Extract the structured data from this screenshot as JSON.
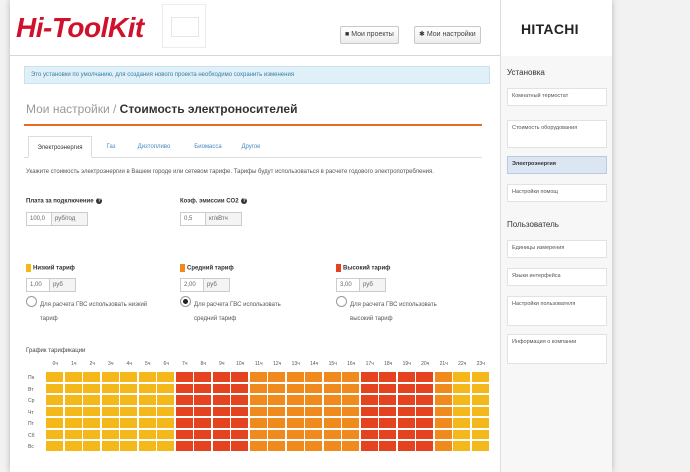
{
  "header": {
    "logo": "Hi-ToolKit",
    "btn_project": "Мои проекты",
    "btn_settings": "Мои настройки",
    "brand": "HITACHI"
  },
  "notice": "Это установки по умолчанию, для создания нового проекта необходимо сохранить изменения",
  "title": {
    "parent": "Мои настройки / ",
    "current": "Стоимость электроносителей"
  },
  "tabs": [
    "Электроэнергия",
    "Газ",
    "Дизтопливо",
    "Биомасса",
    "Другое"
  ],
  "description": "Укажите стоимость электроэнергии в Вашем городе или сетевом тарифе. Тарифы будут использоваться в расчете годового электропотребления.",
  "fields": {
    "subscription_label": "Плата за подключение",
    "subscription_value": "100,0",
    "subscription_unit": "руб/год",
    "co2_label": "Коэф. эмиссии CO2",
    "co2_value": "0,5",
    "co2_unit": "кг/кВтч"
  },
  "tariffs": [
    {
      "label": "Низкий тариф",
      "value": "1,00",
      "unit": "руб",
      "color": "#f4b81a",
      "radio_text": "Для расчета ГВС использовать низкий тариф",
      "selected": false
    },
    {
      "label": "Средний тариф",
      "value": "2,00",
      "unit": "руб",
      "color": "#f08a1d",
      "radio_text": "Для расчета ГВС использовать средний тариф",
      "selected": true
    },
    {
      "label": "Высокий тариф",
      "value": "3,00",
      "unit": "руб",
      "color": "#e5421f",
      "radio_text": "Для расчета ГВС использовать высокий тариф",
      "selected": false
    }
  ],
  "graph_label": "График тарификации",
  "hours": [
    "0ч",
    "1ч",
    "2ч",
    "3ч",
    "4ч",
    "5ч",
    "6ч",
    "7ч",
    "8ч",
    "9ч",
    "10ч",
    "11ч",
    "12ч",
    "13ч",
    "14ч",
    "15ч",
    "16ч",
    "17ч",
    "18ч",
    "19ч",
    "20ч",
    "21ч",
    "22ч",
    "23ч"
  ],
  "days": [
    "Пн",
    "Вт",
    "Ср",
    "Чт",
    "Пт",
    "Сб",
    "Вс"
  ],
  "schedule_row": [
    0,
    0,
    0,
    0,
    0,
    0,
    0,
    2,
    2,
    2,
    2,
    1,
    1,
    1,
    1,
    1,
    1,
    2,
    2,
    2,
    2,
    1,
    0,
    0
  ],
  "sidebar": {
    "heading_install": "Установка",
    "install_items": [
      "Комнатный термостат",
      "Стоимость оборудования",
      "Электроэнергия",
      "Настройки помощ"
    ],
    "active_index": 2,
    "heading_user": "Пользователь",
    "user_items": [
      "Единицы измерения",
      "Языки интерфейса",
      "Настройки пользователя",
      "Информация о компании"
    ]
  }
}
